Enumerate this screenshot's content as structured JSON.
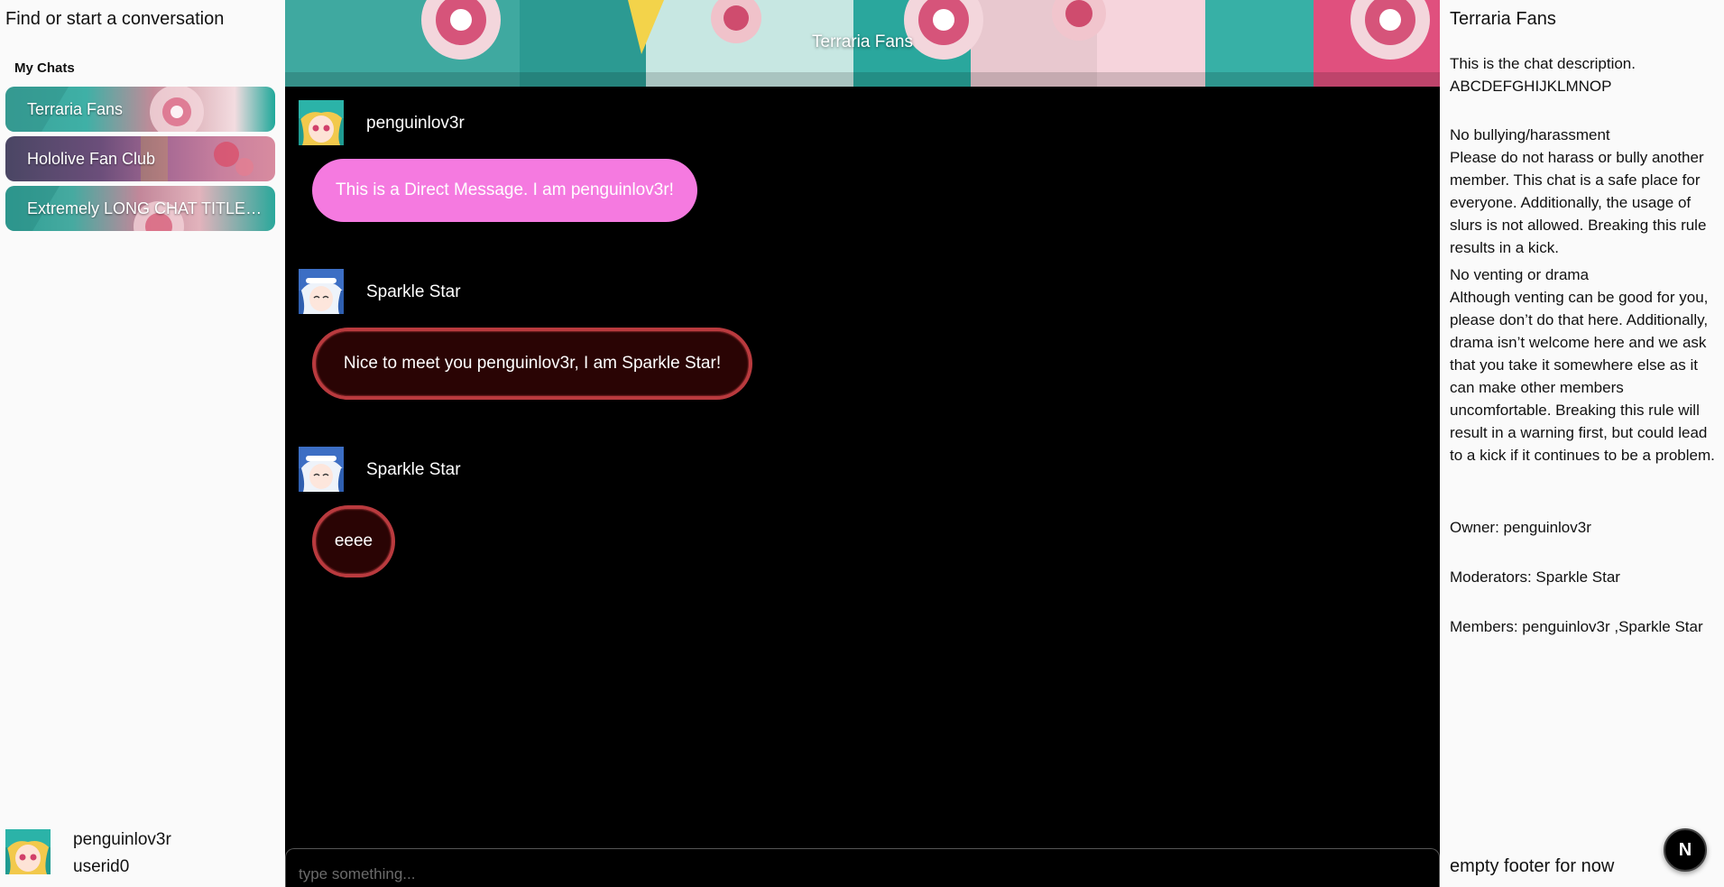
{
  "sidebar": {
    "find_label": "Find or start a conversation",
    "section_title": "My Chats",
    "chats": [
      {
        "label": "Terraria Fans"
      },
      {
        "label": "Hololive Fan Club"
      },
      {
        "label": "Extremely LONG CHAT TITLE T..."
      }
    ],
    "current_user": {
      "name": "penguinlov3r",
      "id": "userid0"
    }
  },
  "chat": {
    "title": "Terraria Fans",
    "messages": [
      {
        "author": "penguinlov3r",
        "text": "This is a Direct Message. I am penguinlov3r!"
      },
      {
        "author": "Sparkle Star",
        "text": "Nice to meet you penguinlov3r, I am Sparkle Star!"
      },
      {
        "author": "Sparkle Star",
        "text": "eeee"
      }
    ],
    "input_placeholder": "type something..."
  },
  "details": {
    "title": "Terraria Fans",
    "description": [
      "This is the chat description.",
      "ABCDEFGHIJKLMNOP"
    ],
    "rules": [
      {
        "title": "No bullying/harassment",
        "body": "Please do not harass or bully another member. This chat is a safe place for everyone. Additionally, the usage of slurs is not allowed. Breaking this rule results in a kick."
      },
      {
        "title": "No venting or drama",
        "body": "Although venting can be good for you, please don’t do that here. Additionally, drama isn’t welcome here and we ask that you take it somewhere else as it can make other members uncomfortable. Breaking this rule will result in a warning first, but could lead to a kick if it continues to be a problem."
      }
    ],
    "owner": "Owner: penguinlov3r",
    "moderators": "Moderators: Sparkle Star",
    "members": "Members: penguinlov3r ,Sparkle Star",
    "footer": "empty footer for now"
  },
  "badge": {
    "letter": "N"
  },
  "colors": {
    "pink_bubble": "#f57ae0",
    "red_bubble_border": "#b93a3e",
    "red_bubble_fill": "#2a0404",
    "chat_bg": "#000000",
    "panel_bg": "#fafafa"
  },
  "icons": {
    "penguin_avatar": "teal-haired-anime-avatar-icon",
    "sparkle_avatar": "blue-haired-anime-avatar-icon",
    "badge": "n-logo-icon"
  }
}
